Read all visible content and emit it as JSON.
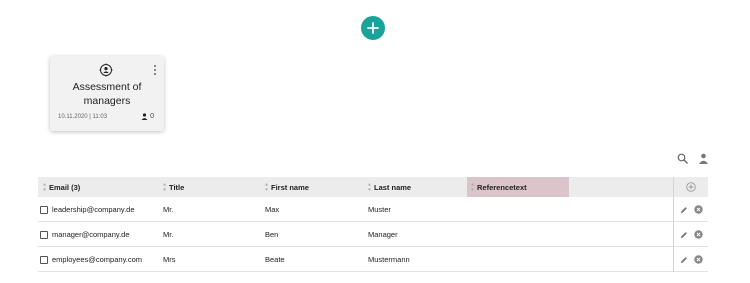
{
  "toolbar": {
    "add_icon": "plus-icon",
    "search_icon": "search-icon",
    "user_icon": "user-icon"
  },
  "card": {
    "title": "Assessment of managers",
    "date": "10.11.2020 | 11:03",
    "count": "0",
    "icon": "person-target-icon"
  },
  "table": {
    "columns": [
      {
        "label": "Email (3)"
      },
      {
        "label": "Title"
      },
      {
        "label": "First name"
      },
      {
        "label": "Last name"
      },
      {
        "label": "Referencetext"
      }
    ],
    "rows": [
      {
        "email": "leadership@company.de",
        "title": "Mr.",
        "first_name": "Max",
        "last_name": "Muster"
      },
      {
        "email": "manager@company.de",
        "title": "Mr.",
        "first_name": "Ben",
        "last_name": "Manager"
      },
      {
        "email": "employees@company.com",
        "title": "Mrs",
        "first_name": "Beate",
        "last_name": "Mustermann"
      }
    ]
  },
  "colors": {
    "accent": "#1aa39a",
    "highlight_column": "#dcc4cb",
    "header_bg": "#ececec"
  }
}
